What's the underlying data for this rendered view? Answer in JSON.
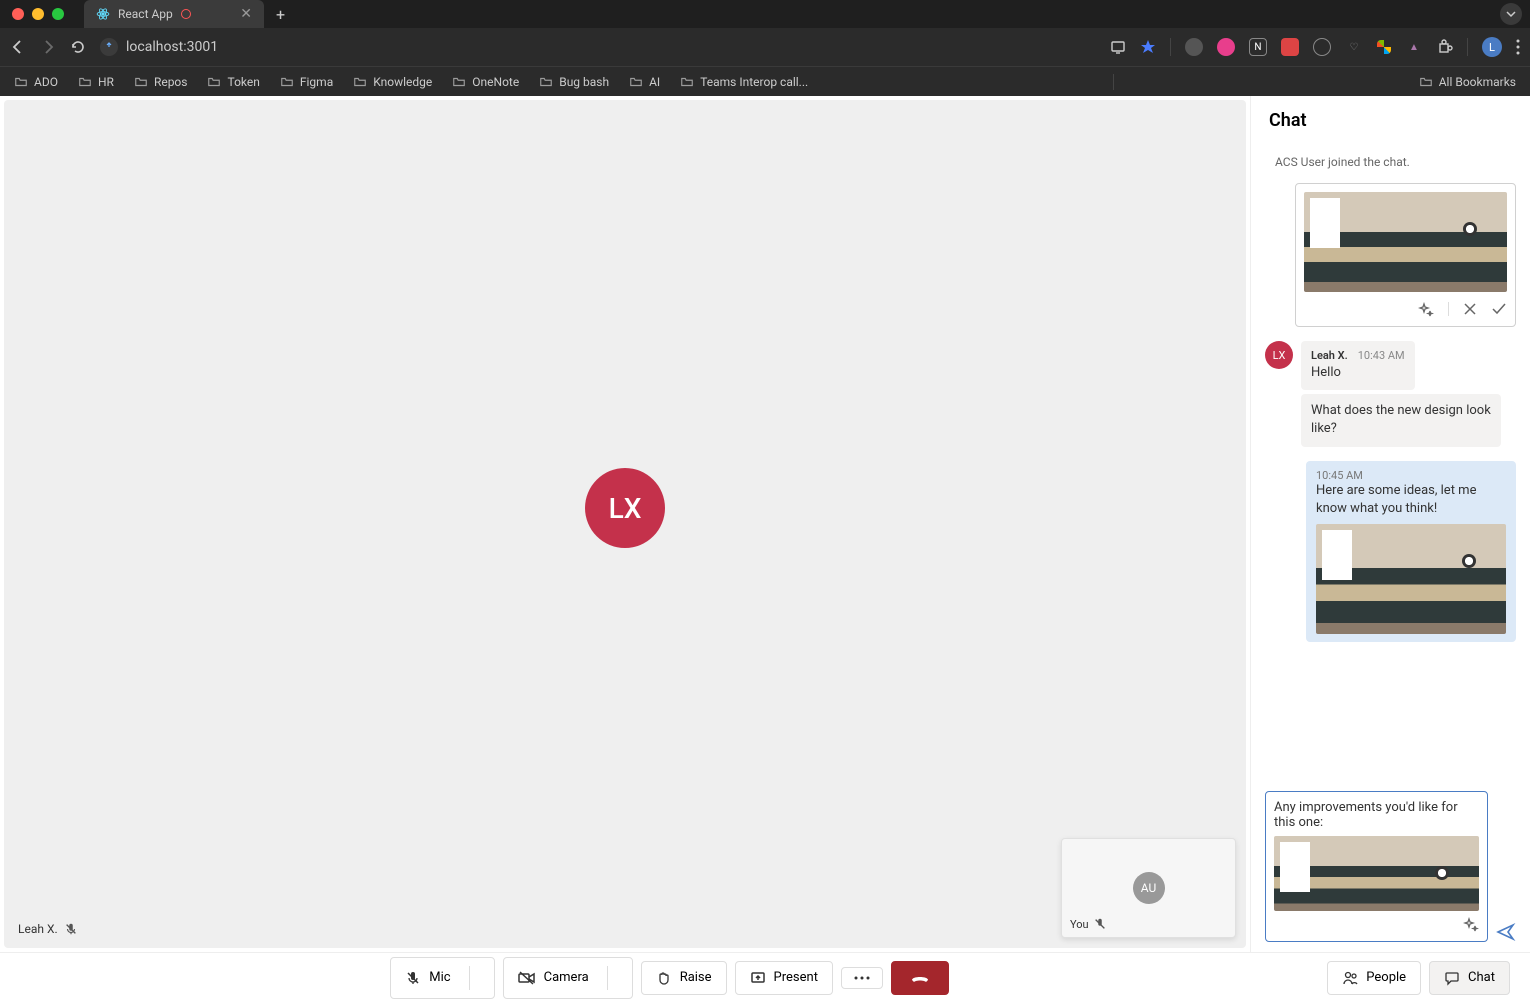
{
  "browser": {
    "tab_title": "React App",
    "url": "localhost:3001",
    "bookmarks": [
      "ADO",
      "HR",
      "Repos",
      "Token",
      "Figma",
      "Knowledge",
      "OneNote",
      "Bug bash",
      "AI",
      "Teams Interop call..."
    ],
    "all_bookmarks_label": "All Bookmarks",
    "profile_initial": "L"
  },
  "video": {
    "main_participant_initials": "LX",
    "main_participant_name": "Leah X.",
    "self_initials": "AU",
    "self_label": "You"
  },
  "chat": {
    "header": "Chat",
    "system_message": "ACS User joined the chat.",
    "messages": [
      {
        "sender": "Leah X.",
        "sender_initials": "LX",
        "time": "10:43 AM",
        "text": "Hello"
      },
      {
        "text": "What does the new design look like?"
      },
      {
        "time": "10:45 AM",
        "text": "Here are some ideas, let me know what you think!"
      }
    ],
    "composer_text": "Any improvements you'd like for this one:"
  },
  "callbar": {
    "mic": "Mic",
    "camera": "Camera",
    "raise": "Raise",
    "present": "Present",
    "people": "People",
    "chat": "Chat"
  }
}
